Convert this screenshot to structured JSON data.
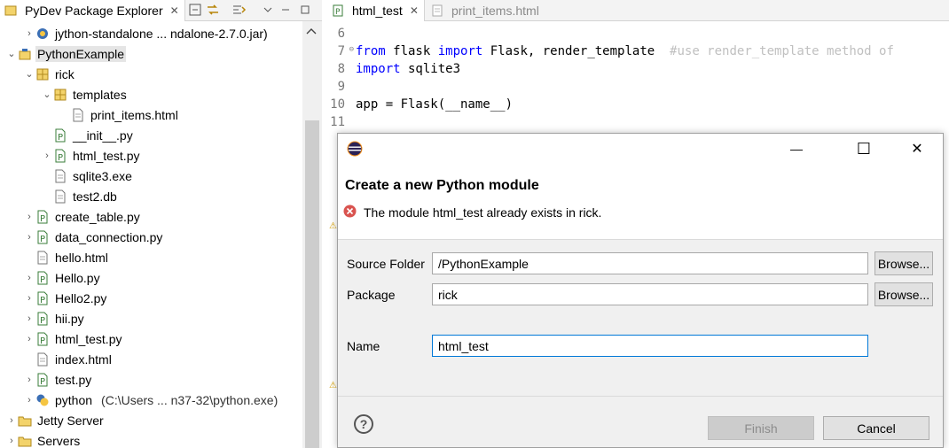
{
  "explorer": {
    "tab_title": "PyDev Package Explorer",
    "close": "✕",
    "tree": [
      {
        "label": "jython-standalone ... ndalone-2.7.0.jar)",
        "icon": "jar-icon",
        "arrow": "›",
        "depth": 1
      },
      {
        "label": "PythonExample",
        "icon": "python-project-icon",
        "arrow": "⌄",
        "depth": 0,
        "selected": true
      },
      {
        "label": "rick",
        "icon": "package-icon",
        "arrow": "⌄",
        "depth": 1
      },
      {
        "label": "templates",
        "icon": "package-icon",
        "arrow": "⌄",
        "depth": 2
      },
      {
        "label": "print_items.html",
        "icon": "file-icon",
        "arrow": "",
        "depth": 3
      },
      {
        "label": "__init__.py",
        "icon": "python-file-icon",
        "arrow": "",
        "depth": 2
      },
      {
        "label": "html_test.py",
        "icon": "python-file-icon",
        "arrow": "›",
        "depth": 2
      },
      {
        "label": "sqlite3.exe",
        "icon": "file-icon",
        "arrow": "",
        "depth": 2
      },
      {
        "label": "test2.db",
        "icon": "file-icon",
        "arrow": "",
        "depth": 2
      },
      {
        "label": "create_table.py",
        "icon": "python-file-icon",
        "arrow": "›",
        "depth": 1
      },
      {
        "label": "data_connection.py",
        "icon": "python-file-icon",
        "arrow": "›",
        "depth": 1
      },
      {
        "label": "hello.html",
        "icon": "file-icon",
        "arrow": "",
        "depth": 1
      },
      {
        "label": "Hello.py",
        "icon": "python-file-icon",
        "arrow": "›",
        "depth": 1
      },
      {
        "label": "Hello2.py",
        "icon": "python-file-icon",
        "arrow": "›",
        "depth": 1
      },
      {
        "label": "hii.py",
        "icon": "python-file-icon",
        "arrow": "›",
        "depth": 1
      },
      {
        "label": "html_test.py",
        "icon": "python-file-icon",
        "arrow": "›",
        "depth": 1
      },
      {
        "label": "index.html",
        "icon": "file-icon",
        "arrow": "",
        "depth": 1
      },
      {
        "label": "test.py",
        "icon": "python-file-icon",
        "arrow": "›",
        "depth": 1
      },
      {
        "label": "python",
        "hint": "(C:\\Users ... n37-32\\python.exe)",
        "icon": "python-interpreter-icon",
        "arrow": "›",
        "depth": 1
      },
      {
        "label": "Jetty Server",
        "icon": "folder-icon",
        "arrow": "›",
        "depth": 0
      },
      {
        "label": "Servers",
        "icon": "folder-icon",
        "arrow": "›",
        "depth": 0
      }
    ]
  },
  "editor": {
    "tabs": [
      {
        "title": "html_test",
        "active": true,
        "close": "✕"
      },
      {
        "title": "print_items.html",
        "active": false
      }
    ],
    "lines": [
      {
        "n": "6",
        "tokens": []
      },
      {
        "n": "7",
        "fold": "⊖",
        "tokens": [
          {
            "t": "from",
            "c": "kw"
          },
          {
            "t": " flask ",
            "c": "txt"
          },
          {
            "t": "import",
            "c": "kw"
          },
          {
            "t": " Flask, render_template  ",
            "c": "txt"
          },
          {
            "t": "#use render_template method of",
            "c": "cm"
          }
        ]
      },
      {
        "n": "8",
        "tokens": [
          {
            "t": "import",
            "c": "kw"
          },
          {
            "t": " sqlite3",
            "c": "txt"
          }
        ]
      },
      {
        "n": "9",
        "tokens": []
      },
      {
        "n": "10",
        "tokens": [
          {
            "t": "app = Flask(__name__)",
            "c": "txt"
          }
        ]
      },
      {
        "n": "11",
        "tokens": []
      }
    ]
  },
  "dialog": {
    "minimize": "—",
    "maximize": "☐",
    "close": "✕",
    "title": "Create a new Python module",
    "error": "The module html_test already exists in rick.",
    "source_folder_label": "Source Folder",
    "source_folder_value": "/PythonExample",
    "package_label": "Package",
    "package_value": "rick",
    "name_label": "Name",
    "name_value": "html_test",
    "browse_label": "Browse...",
    "help": "?",
    "finish_label": "Finish",
    "cancel_label": "Cancel"
  }
}
